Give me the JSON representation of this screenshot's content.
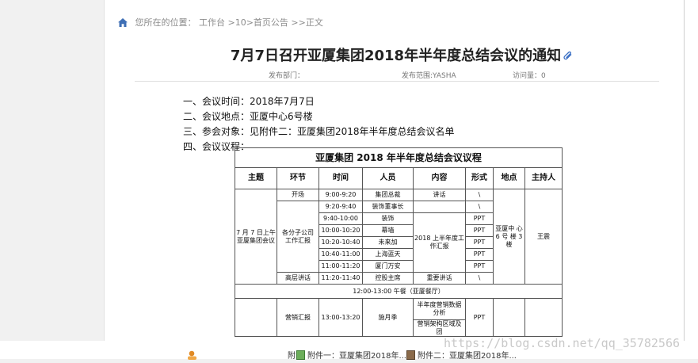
{
  "breadcrumb": {
    "prefix": "您所在的位置：",
    "path": "工作台 >10>首页公告 >>正文"
  },
  "notice": {
    "title": "7月7日召开亚厦集团2018年半年度总结会议的通知",
    "meta": {
      "dept_label": "发布部门：",
      "scope_label": "发布范围:YASHA",
      "views_label": "访问量：0"
    },
    "items": [
      "一、会议时间：2018年7月7日",
      "二、会议地点：亚厦中心6号楼",
      "三、参会对象：见附件二：亚厦集团2018年半年度总结会议名单",
      "四、会议议程："
    ]
  },
  "agenda": {
    "caption": "亚厦集团 2018 年半年度总结会议议程",
    "headers": [
      "主题",
      "环节",
      "时间",
      "人员",
      "内容",
      "形式",
      "地点",
      "主持人"
    ],
    "theme": "7 月 7 日上午 亚厦集团会议",
    "location": "亚厦中 心 6 号 楼 3 楼",
    "host": "王震",
    "opening": {
      "segment": "开场",
      "time": "9:00-9:20",
      "person": "集团总裁",
      "content": "讲话",
      "form": "\\"
    },
    "branch_segment": "各分子公司 工作汇报",
    "branch_content": "2018 上半年度工 作汇报",
    "branch_rows": [
      {
        "time": "9:20-9:40",
        "person": "装饰董事长",
        "form": "\\"
      },
      {
        "time": "9:40-10:00",
        "person": "装饰",
        "form": "PPT"
      },
      {
        "time": "10:00-10:20",
        "person": "幕墙",
        "form": "PPT"
      },
      {
        "time": "10:20-10:40",
        "person": "未来加",
        "form": "PPT"
      },
      {
        "time": "10:40-11:00",
        "person": "上海蓝天",
        "form": "PPT"
      },
      {
        "time": "11:00-11:20",
        "person": "厦门万安",
        "form": "PPT"
      }
    ],
    "senior": {
      "segment": "高层讲话",
      "time": "11:20-11:40",
      "person": "控股主席",
      "content": "重要讲话",
      "form": "\\"
    },
    "lunch": "12:00-13:00 午餐（亚厦餐厅）",
    "marketing": {
      "segment": "营销汇报",
      "time": "13:00-13:20",
      "person": "施月季",
      "content1": "半年度营销数据分析",
      "content2": "营销架构区域及团",
      "form": "PPT"
    }
  },
  "attachments": {
    "label": "附",
    "file1": "附件一：亚厦集团2018年...",
    "file2": "附件二：亚厦集团2018年..."
  },
  "watermark": "https://blog.csdn.net/qq_35782566"
}
